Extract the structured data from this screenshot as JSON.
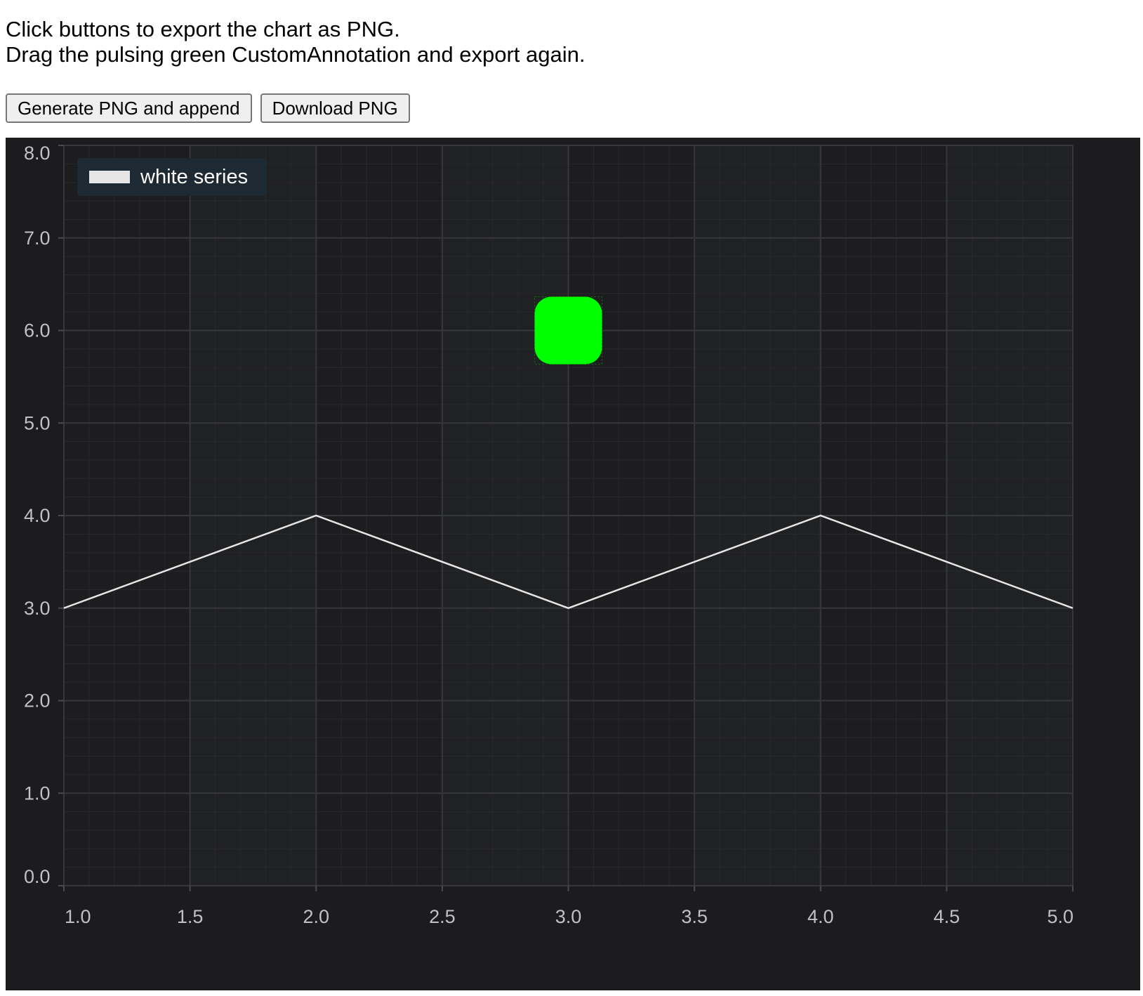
{
  "intro": {
    "line1": "Click buttons to export the chart as PNG.",
    "line2": "Drag the pulsing green CustomAnnotation and export again."
  },
  "toolbar": {
    "generate_label": "Generate PNG and append",
    "download_label": "Download PNG"
  },
  "colors": {
    "chart_background": "#1c1c1e",
    "series_line": "#e6e6e6",
    "annotation": "#00ff00",
    "legend_background": "#1e2a33"
  },
  "chart_data": {
    "type": "line",
    "series": [
      {
        "name": "white series",
        "x": [
          1.0,
          2.0,
          3.0,
          4.0,
          5.0
        ],
        "y": [
          3.0,
          4.0,
          3.0,
          4.0,
          3.0
        ]
      }
    ],
    "xlim": [
      1.0,
      5.0
    ],
    "ylim": [
      0.0,
      8.0
    ],
    "x_ticks": [
      "1.0",
      "1.5",
      "2.0",
      "2.5",
      "3.0",
      "3.5",
      "4.0",
      "4.5",
      "5.0"
    ],
    "y_ticks": [
      "0.0",
      "1.0",
      "2.0",
      "3.0",
      "4.0",
      "5.0",
      "6.0",
      "7.0",
      "8.0"
    ],
    "grid": true,
    "legend_position": "top-left",
    "annotation": {
      "type": "custom",
      "shape": "rounded-square",
      "x": 3.0,
      "y": 6.0
    }
  }
}
